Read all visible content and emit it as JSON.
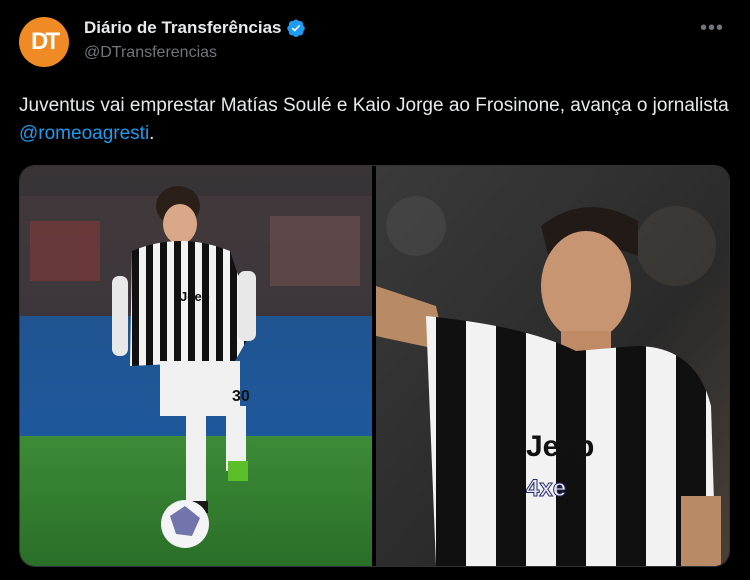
{
  "author": {
    "display_name": "Diário de Transferências",
    "handle": "@DTransferencias",
    "avatar_text": "DT",
    "verified": true
  },
  "more_label": "•••",
  "tweet": {
    "text_before": "Juventus vai emprestar Matías Soulé e Kaio Jorge ao Frosinone, avança o jornalista ",
    "mention": "@romeoagresti",
    "text_after": "."
  },
  "media": {
    "left_photo": {
      "shirt_number": "30",
      "sponsor": "Jeep"
    },
    "right_photo": {
      "sponsor": "Jeep",
      "sleeve_sponsor": "4xe"
    }
  },
  "colors": {
    "avatar_bg": "#f08a24",
    "mention": "#1d9bf0",
    "verified": "#1d9bf0",
    "pitch": "#2f7a2c"
  }
}
